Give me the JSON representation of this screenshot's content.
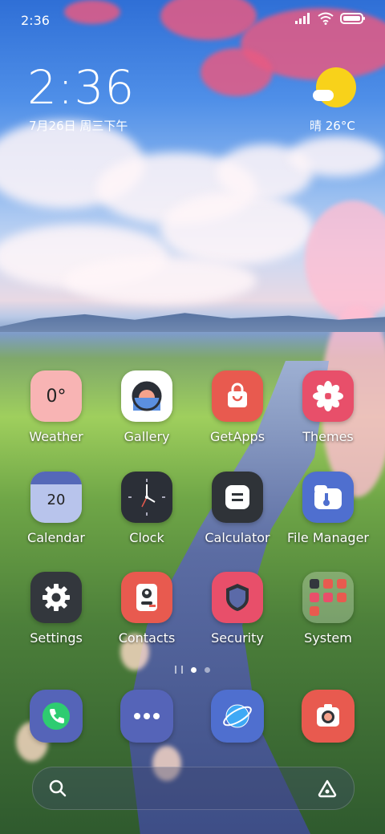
{
  "status_bar": {
    "time": "2:36",
    "icons": [
      "signal-icon",
      "wifi-icon",
      "battery-icon"
    ]
  },
  "clock_widget": {
    "time": "2:36",
    "date": "7月26日 周三下午"
  },
  "weather_widget": {
    "icon": "sunny-cloud-icon",
    "text": "晴 26°C"
  },
  "apps": [
    {
      "name": "weather",
      "label": "Weather",
      "tile_text": "0°",
      "color": "#f8b4b4"
    },
    {
      "name": "gallery",
      "label": "Gallery",
      "color": "#ffffff"
    },
    {
      "name": "getapps",
      "label": "GetApps",
      "color": "#e85a4f"
    },
    {
      "name": "themes",
      "label": "Themes",
      "color": "#e84f6a"
    },
    {
      "name": "calendar",
      "label": "Calendar",
      "tile_text": "20",
      "color": "#b8c4ec"
    },
    {
      "name": "clock",
      "label": "Clock",
      "color": "#2b2f37"
    },
    {
      "name": "calculator",
      "label": "Calculator",
      "color": "#2f3338"
    },
    {
      "name": "file-manager",
      "label": "File Manager",
      "color": "#4f6fcf"
    },
    {
      "name": "settings",
      "label": "Settings",
      "color": "#33373d"
    },
    {
      "name": "contacts",
      "label": "Contacts",
      "color": "#e85a4f"
    },
    {
      "name": "security",
      "label": "Security",
      "color": "#e84f6a"
    },
    {
      "name": "system",
      "label": "System",
      "color": "rgba(255,255,255,0.25)"
    }
  ],
  "page_indicator": {
    "total": 2,
    "active": 0
  },
  "dock": [
    {
      "name": "phone",
      "icon": "phone-icon",
      "color": "#5564b8"
    },
    {
      "name": "messaging",
      "icon": "chat-icon",
      "color": "#5564b8"
    },
    {
      "name": "browser",
      "icon": "browser-icon",
      "color": "#4f6fcf"
    },
    {
      "name": "camera",
      "icon": "camera-icon",
      "color": "#e85a4f"
    }
  ],
  "search_bar": {
    "left_icon": "search-icon",
    "right_icon": "assistant-icon"
  }
}
